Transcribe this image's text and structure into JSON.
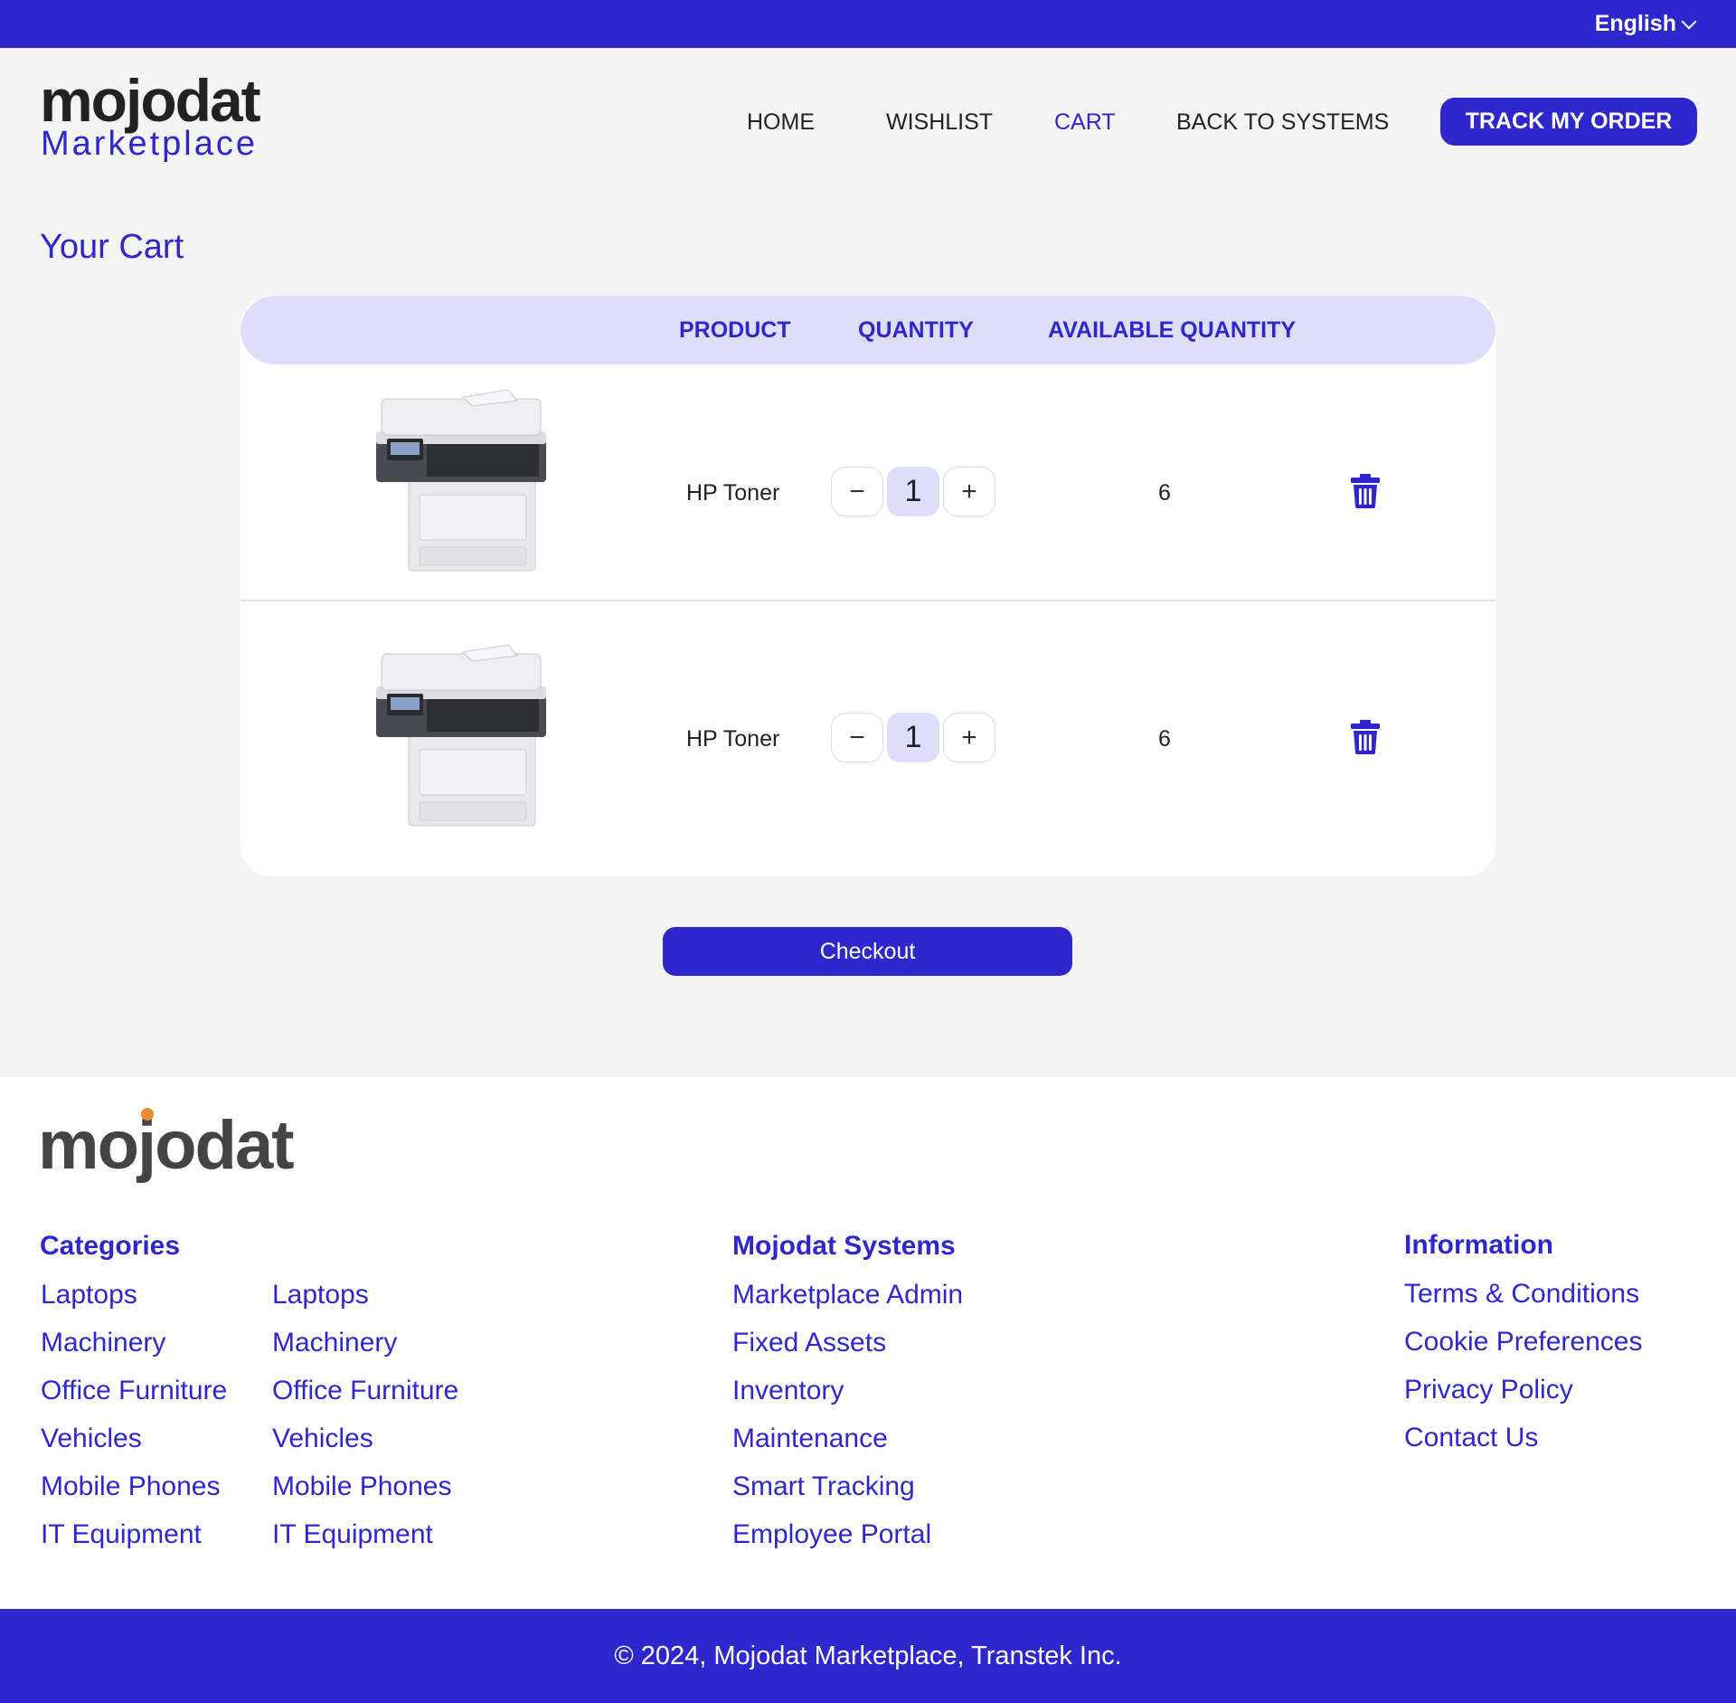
{
  "topbar": {
    "language": "English"
  },
  "header": {
    "logo_brand": "mojodat",
    "logo_sub": "Marketplace",
    "nav": [
      "HOME",
      "WISHLIST",
      "CART",
      "BACK TO SYSTEMS"
    ],
    "track_order": "TRACK MY ORDER"
  },
  "page": {
    "title": "Your Cart"
  },
  "cart": {
    "columns": {
      "product": "PRODUCT",
      "quantity": "QUANTITY",
      "available": "AVAILABLE QUANTITY"
    },
    "items": [
      {
        "name": "HP Toner",
        "quantity": "1",
        "available": "6",
        "minus": "−",
        "plus": "+"
      },
      {
        "name": "HP Toner",
        "quantity": "1",
        "available": "6",
        "minus": "−",
        "plus": "+"
      }
    ],
    "checkout": "Checkout"
  },
  "footer": {
    "logo": "mojodat",
    "categories": {
      "heading": "Categories",
      "col1": [
        "Laptops",
        "Machinery",
        "Office Furniture",
        "Vehicles",
        "Mobile Phones",
        "IT Equipment"
      ],
      "col2": [
        "Laptops",
        "Machinery",
        "Office Furniture",
        "Vehicles",
        "Mobile Phones",
        "IT Equipment"
      ]
    },
    "systems": {
      "heading": "Mojodat Systems",
      "links": [
        "Marketplace Admin",
        "Fixed Assets",
        "Inventory",
        "Maintenance",
        "Smart Tracking",
        "Employee Portal"
      ]
    },
    "information": {
      "heading": "Information",
      "links": [
        "Terms & Conditions",
        "Cookie Preferences",
        "Privacy Policy",
        "Contact Us"
      ]
    },
    "copyright": "© 2024, Mojodat Marketplace, Transtek Inc."
  },
  "colors": {
    "brand": "#2f27ce",
    "header_band": "#dedefb",
    "logo_dot": "#f08a2c"
  },
  "icons": [
    "chevron-down-icon",
    "trash-icon",
    "printer-image"
  ]
}
